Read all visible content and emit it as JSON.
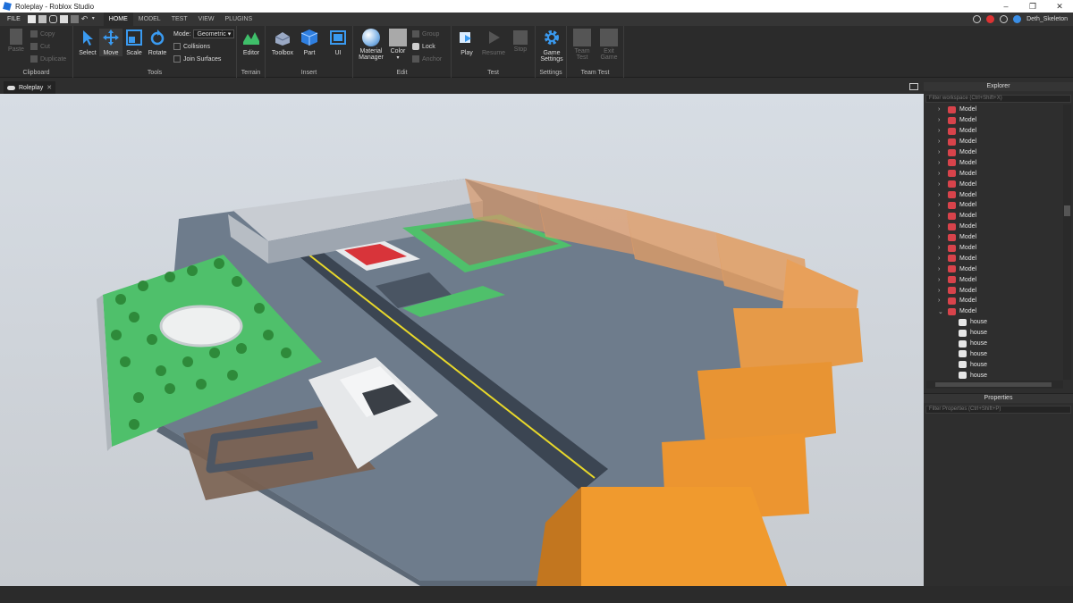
{
  "window": {
    "title": "Roleplay - Roblox Studio",
    "controls": [
      "–",
      "❐",
      "✕"
    ]
  },
  "menubar": {
    "file": "FILE",
    "tabs": [
      "HOME",
      "MODEL",
      "TEST",
      "VIEW",
      "PLUGINS"
    ],
    "active_tab": "HOME",
    "username": "Deth_Skeleton"
  },
  "ribbon": {
    "clipboard": {
      "paste": "Paste",
      "copy": "Copy",
      "cut": "Cut",
      "duplicate": "Duplicate",
      "label": "Clipboard"
    },
    "tools": {
      "select": "Select",
      "move": "Move",
      "scale": "Scale",
      "rotate": "Rotate",
      "mode_label": "Mode:",
      "mode_value": "Geometric",
      "collisions": "Collisions",
      "join_surfaces": "Join Surfaces",
      "label": "Tools"
    },
    "terrain": {
      "editor": "Editor",
      "label": "Terrain"
    },
    "insert": {
      "toolbox": "Toolbox",
      "part": "Part",
      "ui": "UI",
      "label": "Insert"
    },
    "edit": {
      "material_manager_1": "Material",
      "material_manager_2": "Manager",
      "color": "Color",
      "group": "Group",
      "lock": "Lock",
      "anchor": "Anchor",
      "label": "Edit"
    },
    "test": {
      "play": "Play",
      "resume": "Resume",
      "stop": "Stop",
      "label": "Test"
    },
    "settings": {
      "game_settings_1": "Game",
      "game_settings_2": "Settings",
      "label": "Settings"
    },
    "team_test": {
      "team_test_1": "Team",
      "team_test_2": "Test",
      "exit_game_1": "Exit",
      "exit_game_2": "Game",
      "label": "Team Test"
    }
  },
  "document_tab": {
    "label": "Roleplay",
    "close": "✕"
  },
  "explorer": {
    "title": "Explorer",
    "filter_placeholder": "Filter workspace (Ctrl+Shift+X)",
    "models": [
      "Model",
      "Model",
      "Model",
      "Model",
      "Model",
      "Model",
      "Model",
      "Model",
      "Model",
      "Model",
      "Model",
      "Model",
      "Model",
      "Model",
      "Model",
      "Model",
      "Model",
      "Model",
      "Model",
      "Model"
    ],
    "houses": [
      "house",
      "house",
      "house",
      "house",
      "house",
      "house"
    ]
  },
  "properties": {
    "title": "Properties",
    "filter_placeholder": "Filter Properties (Ctrl+Shift+P)"
  },
  "colors": {
    "accent": "#1e6fd9",
    "model_icon": "#d8434b",
    "terrain_green": "#3fbf6a",
    "house_orange": "#e89a3c"
  }
}
